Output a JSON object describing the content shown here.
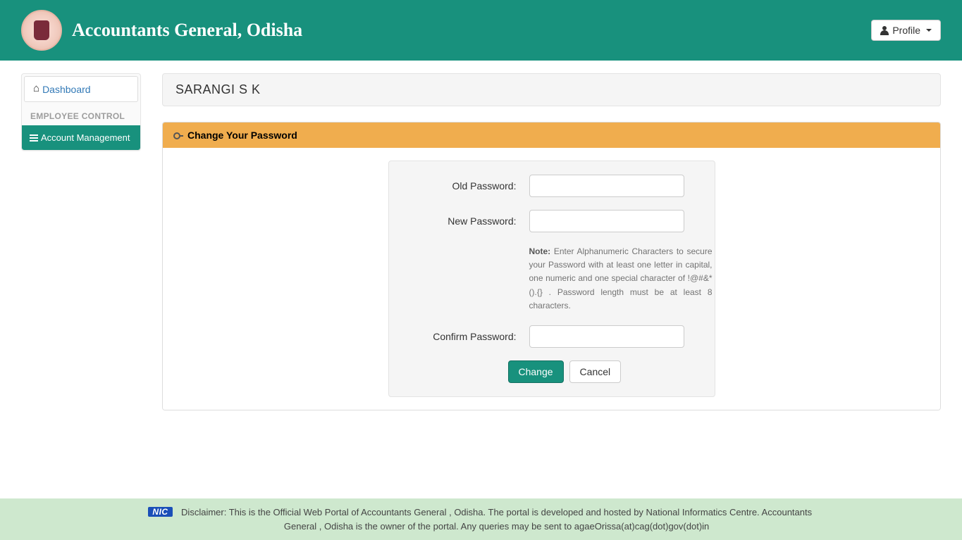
{
  "header": {
    "brand": "Accountants General, Odisha",
    "profile_label": "Profile"
  },
  "sidebar": {
    "dashboard_label": "Dashboard",
    "section_header": "EMPLOYEE CONTROL",
    "account_mgmt_label": "Account Management"
  },
  "main": {
    "user_name": "SARANGI S K",
    "panel_title": "Change Your Password",
    "labels": {
      "old_password": "Old Password:",
      "new_password": "New Password:",
      "confirm_password": "Confirm Password:"
    },
    "note_prefix": "Note:",
    "note_text": " Enter Alphanumeric Characters to secure your Password with at least one letter in capital, one numeric and one special character of !@#&*().{} . Password length must be at least 8 characters.",
    "change_btn": "Change",
    "cancel_btn": "Cancel"
  },
  "footer": {
    "nic": "NIC",
    "disclaimer": "Disclaimer: This is the Official Web Portal of Accountants General , Odisha. The portal is developed and hosted by National Informatics Centre. Accountants General , Odisha is the owner of the portal. Any queries may be sent to agaeOrissa(at)cag(dot)gov(dot)in"
  }
}
